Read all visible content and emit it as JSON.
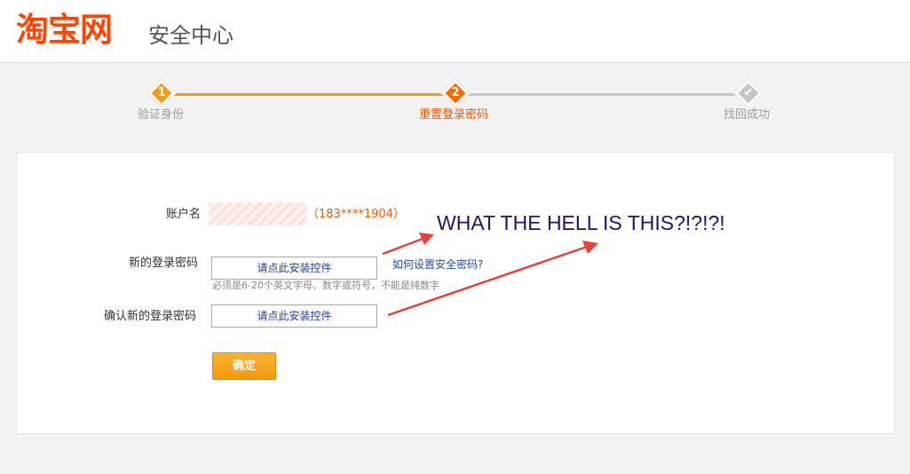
{
  "header": {
    "logo_text": "淘宝网",
    "section_title": "安全中心"
  },
  "progress": {
    "steps": [
      {
        "number": "1",
        "label": "验证身份",
        "state": "done"
      },
      {
        "number": "2",
        "label": "重置登录密码",
        "state": "active"
      },
      {
        "number": "✔",
        "label": "找回成功",
        "state": "pending"
      }
    ],
    "colors": {
      "done": "#f49b1b",
      "active": "#f96a00",
      "pending": "#c6c6c6"
    }
  },
  "form": {
    "account_label": "账户名",
    "account_phone": "（183****1904）",
    "new_password_label": "新的登录密码",
    "new_password_placeholder": "请点此安装控件",
    "help_link": "如何设置安全密码?",
    "password_hint": "必须是6-20个英文字母、数字或符号，不能是纯数字",
    "confirm_password_label": "确认新的登录密码",
    "confirm_password_placeholder": "请点此安装控件",
    "submit_label": "确定"
  },
  "annotation": {
    "text": "WHAT THE HELL IS THIS?!?!?!",
    "arrow_color": "#e8413c"
  }
}
